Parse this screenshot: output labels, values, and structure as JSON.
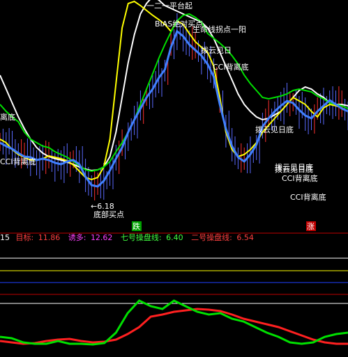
{
  "chart_data": {
    "type": "line",
    "indicator_legend": {
      "period": "15",
      "items": [
        {
          "label": "目标:",
          "value": "11.86",
          "color": "#ff4040"
        },
        {
          "label": "诱多:",
          "value": "12.62",
          "color": "#ff40ff"
        },
        {
          "label": "七号操盘线:",
          "value": "6.40",
          "color": "#40ff40"
        },
        {
          "label": "二号操盘线:",
          "value": "6.54",
          "color": "#ff4040"
        }
      ]
    },
    "signal_tags": [
      {
        "text": "跌",
        "color": "#00a000"
      },
      {
        "text": "涨",
        "color": "#c00000"
      }
    ],
    "annotations": [
      "一二一平台起",
      "BIAS绝对买点",
      "生命线拐点一阳",
      "拨云见日",
      "CCI背离底",
      "离底",
      "CCI背离底",
      "拨云见日底",
      "拨云见日底",
      "拨云见日底",
      "CCI背离底",
      "CCI背离底",
      "←6.18",
      "底部买点"
    ],
    "series": [
      {
        "color": "#ffffff",
        "values": [
          108,
          128,
          148,
          168,
          185,
          200,
          212,
          220,
          225,
          228,
          230,
          233,
          236,
          240,
          243,
          245,
          244,
          240,
          225,
          190,
          140,
          90,
          50,
          20,
          5,
          -5,
          0,
          8,
          12,
          16,
          20,
          24,
          28,
          32,
          40,
          55,
          75,
          95,
          115,
          135,
          150,
          160,
          168,
          172,
          170,
          165,
          160,
          150,
          140,
          130,
          125,
          128,
          135,
          140,
          148,
          150,
          150,
          152
        ]
      },
      {
        "color": "#ffff00",
        "values": [
          200,
          205,
          215,
          222,
          226,
          230,
          230,
          228,
          224,
          226,
          228,
          231,
          237,
          246,
          255,
          258,
          255,
          240,
          200,
          120,
          40,
          5,
          2,
          8,
          15,
          22,
          28,
          35,
          45,
          30,
          35,
          48,
          60,
          68,
          75,
          95,
          140,
          190,
          215,
          225,
          222,
          215,
          205,
          190,
          180,
          170,
          160,
          150,
          140,
          145,
          150,
          160,
          168,
          155,
          150,
          152,
          155,
          160
        ]
      },
      {
        "color": "#00e000",
        "values": [
          150,
          160,
          168,
          175,
          190,
          200,
          205,
          210,
          212,
          218,
          222,
          226,
          232,
          238,
          244,
          246,
          244,
          240,
          232,
          218,
          205,
          190,
          172,
          150,
          128,
          106,
          84,
          64,
          46,
          30,
          22,
          20,
          25,
          32,
          48,
          55,
          62,
          70,
          80,
          92,
          108,
          120,
          130,
          140,
          142,
          140,
          138,
          135,
          130,
          128,
          130,
          132,
          138,
          142,
          148,
          150,
          152,
          156
        ]
      },
      {
        "color": "#4080ff",
        "values": [
          205,
          210,
          214,
          220,
          225,
          226,
          230,
          228,
          230,
          234,
          236,
          232,
          230,
          236,
          254,
          266,
          268,
          260,
          245,
          228,
          212,
          190,
          172,
          156,
          140,
          128,
          112,
          100,
          68,
          45,
          52,
          64,
          72,
          80,
          92,
          110,
          150,
          185,
          210,
          226,
          232,
          222,
          208,
          182,
          170,
          160,
          152,
          145,
          148,
          158,
          166,
          170,
          160,
          152,
          144,
          150,
          156,
          160
        ]
      }
    ],
    "lower_panel": {
      "series": [
        {
          "color": "#ff2020",
          "values": [
            490,
            492,
            494,
            493,
            490,
            488,
            487,
            490,
            492,
            491,
            488,
            480,
            470,
            455,
            452,
            448,
            446,
            444,
            445,
            447,
            452,
            458,
            462,
            466,
            470,
            476,
            482,
            488,
            492,
            494,
            494
          ]
        },
        {
          "color": "#00e000",
          "values": [
            484,
            486,
            492,
            494,
            494,
            490,
            494,
            494,
            495,
            493,
            478,
            450,
            432,
            440,
            444,
            432,
            440,
            448,
            452,
            450,
            458,
            462,
            470,
            478,
            484,
            492,
            494,
            492,
            484,
            480,
            478
          ]
        }
      ]
    }
  }
}
